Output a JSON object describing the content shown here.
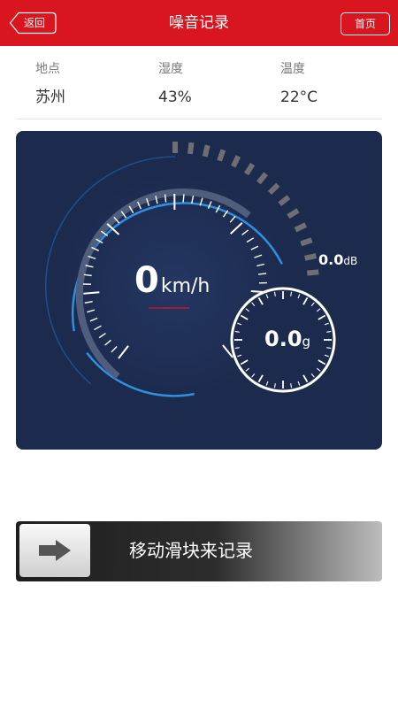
{
  "header": {
    "back_label": "返回",
    "title": "噪音记录",
    "home_label": "首页"
  },
  "info": [
    {
      "label": "地点",
      "value": "苏州"
    },
    {
      "label": "湿度",
      "value": "43%"
    },
    {
      "label": "温度",
      "value": "22°C"
    }
  ],
  "gauge": {
    "speed_value": "0",
    "speed_unit": "km/h",
    "noise_value": "0.0",
    "noise_unit": "dB",
    "g_value": "0.0",
    "g_unit": "g"
  },
  "slider": {
    "label": "移动滑块来记录",
    "progress": 0
  },
  "colors": {
    "header": "#d9161f",
    "panel": "#1c2a4d",
    "accent": "#2f8fe0",
    "needle": "#d9161f"
  },
  "icons": {
    "back": "chevron-left-icon",
    "slider": "arrow-right-icon"
  }
}
